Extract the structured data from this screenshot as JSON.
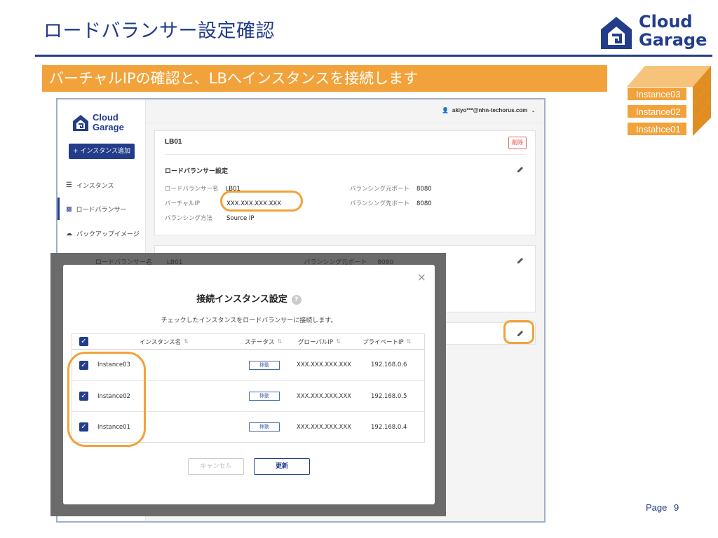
{
  "slide": {
    "title": "ロードバランサー設定確認",
    "banner": "バーチャルIPの確認と、LBへインスタンスを接続します",
    "logo_line1": "Cloud",
    "logo_line2": "Garage",
    "page_label": "Page",
    "page_number": "9",
    "stack_labels": [
      "Instance03",
      "Instance02",
      "Instahce01"
    ]
  },
  "app": {
    "logo_line1": "Cloud",
    "logo_line2": "Garage",
    "add_button": "+ インスタンス追加",
    "nav": [
      {
        "label": "インスタンス",
        "icon": "list-icon"
      },
      {
        "label": "ロードバランサー",
        "icon": "load-balancer-icon"
      },
      {
        "label": "バックアップイメージ",
        "icon": "cloud-icon"
      }
    ],
    "user": "akiyo***@nhn-techorus.com",
    "card1": {
      "title": "LB01",
      "delete_label": "削除",
      "section_title": "ロードバランサー設定",
      "fields": [
        {
          "label": "ロードバランサー名",
          "value": "LB01"
        },
        {
          "label": "バーチャルIP",
          "value": "XXX.XXX.XXX.XXX"
        },
        {
          "label": "バランシング方法",
          "value": "Source IP"
        },
        {
          "label": "バランシング元ポート",
          "value": "8080"
        },
        {
          "label": "バランシング先ポート",
          "value": "8080"
        }
      ]
    },
    "card2": {
      "name_label": "ロードバランサー名",
      "name_value": "LB01",
      "port_label": "バランシング元ポート",
      "port_value": "8080"
    }
  },
  "modal": {
    "title": "接続インスタンス設定",
    "help": "?",
    "description": "チェックしたインスタンスをロードバランサーに接続します。",
    "close": "×",
    "columns": [
      "インスタンス名",
      "ステータス",
      "グローバルIP",
      "プライベートIP"
    ],
    "rows": [
      {
        "name": "Instance03",
        "status": "稼動",
        "global_ip": "XXX.XXX.XXX.XXX",
        "private_ip": "192.168.0.6",
        "checked": true
      },
      {
        "name": "Instance02",
        "status": "稼動",
        "global_ip": "XXX.XXX.XXX.XXX",
        "private_ip": "192.168.0.5",
        "checked": true
      },
      {
        "name": "Instance01",
        "status": "稼動",
        "global_ip": "XXX.XXX.XXX.XXX",
        "private_ip": "192.168.0.4",
        "checked": true
      }
    ],
    "cancel_label": "キャンセル",
    "update_label": "更新"
  },
  "colors": {
    "brand_navy": "#233d8a",
    "accent_orange": "#f2a23a",
    "delete_red": "#e04848"
  }
}
